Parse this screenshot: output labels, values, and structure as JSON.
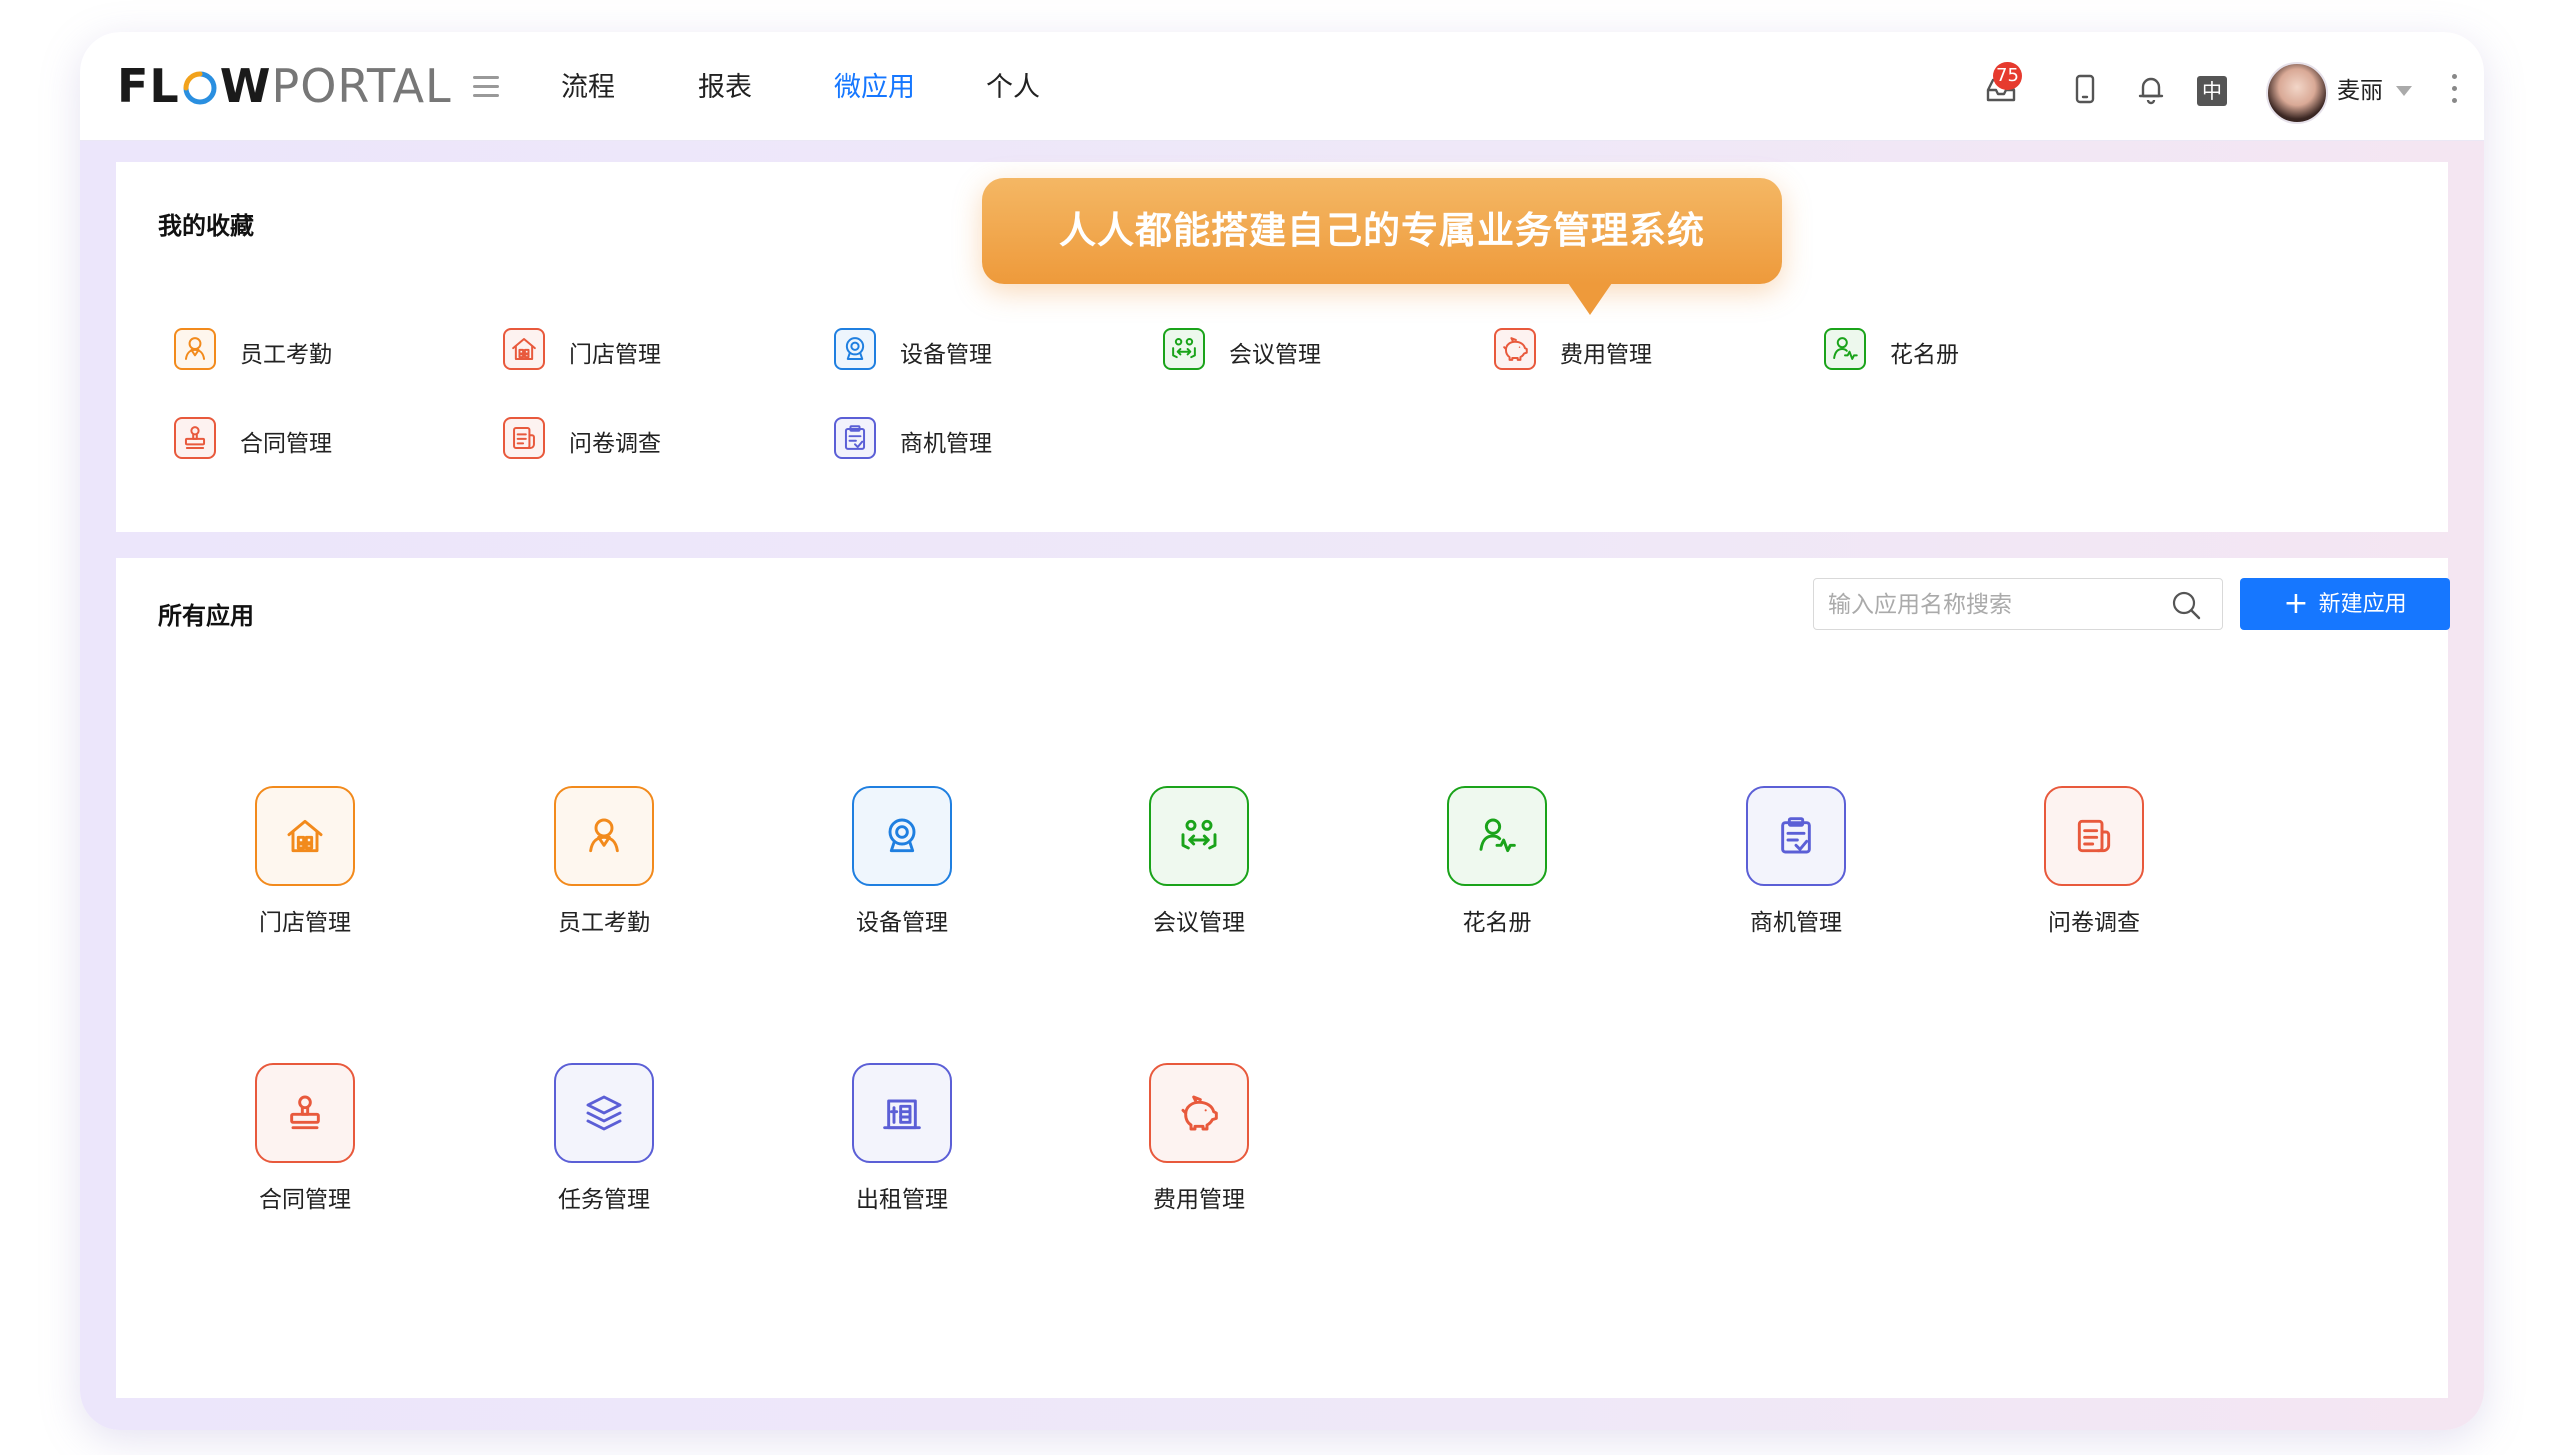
{
  "brand": {
    "logo_bold": "FL",
    "logo_o_icon": "flow-o-logo-icon",
    "logo_bold2": "W",
    "logo_light": "PORTAL"
  },
  "nav": {
    "items": [
      {
        "label": "流程"
      },
      {
        "label": "报表"
      },
      {
        "label": "微应用"
      },
      {
        "label": "个人"
      }
    ],
    "active": "微应用"
  },
  "header": {
    "inbox_badge": "75",
    "lang_label": "中",
    "user_name": "麦丽",
    "icons": [
      "inbox-icon",
      "mobile-icon",
      "bell-icon",
      "language-icon",
      "more-vertical-icon"
    ]
  },
  "tooltip": {
    "text": "人人都能搭建自己的专属业务管理系统"
  },
  "favorites": {
    "title": "我的收藏",
    "items": [
      {
        "label": "员工考勤",
        "icon": "person-icon",
        "color": "#f28a1c"
      },
      {
        "label": "门店管理",
        "icon": "store-icon",
        "color": "#e8593c"
      },
      {
        "label": "设备管理",
        "icon": "webcam-icon",
        "color": "#1f7fe0"
      },
      {
        "label": "会议管理",
        "icon": "meeting-icon",
        "color": "#1aa31a"
      },
      {
        "label": "费用管理",
        "icon": "piggy-bank-icon",
        "color": "#e8593c"
      },
      {
        "label": "花名册",
        "icon": "roster-icon",
        "color": "#1aa31a"
      },
      {
        "label": "合同管理",
        "icon": "stamp-icon",
        "color": "#e8593c"
      },
      {
        "label": "问卷调查",
        "icon": "survey-icon",
        "color": "#e8593c"
      },
      {
        "label": "商机管理",
        "icon": "clipboard-icon",
        "color": "#5b5fd6"
      }
    ]
  },
  "apps": {
    "title": "所有应用",
    "search_placeholder": "输入应用名称搜索",
    "new_button_label": "新建应用",
    "items": [
      {
        "label": "门店管理",
        "icon": "store-icon",
        "color": "#f28a1c"
      },
      {
        "label": "员工考勤",
        "icon": "person-icon",
        "color": "#f28a1c"
      },
      {
        "label": "设备管理",
        "icon": "webcam-icon",
        "color": "#1f7fe0"
      },
      {
        "label": "会议管理",
        "icon": "meeting-icon",
        "color": "#1aa31a"
      },
      {
        "label": "花名册",
        "icon": "roster-icon",
        "color": "#1aa31a"
      },
      {
        "label": "商机管理",
        "icon": "clipboard-icon",
        "color": "#5b5fd6"
      },
      {
        "label": "问卷调查",
        "icon": "survey-icon",
        "color": "#e8593c"
      },
      {
        "label": "合同管理",
        "icon": "stamp-icon",
        "color": "#e8593c"
      },
      {
        "label": "任务管理",
        "icon": "layers-icon",
        "color": "#5b5fd6"
      },
      {
        "label": "出租管理",
        "icon": "building-icon",
        "color": "#5b5fd6"
      },
      {
        "label": "费用管理",
        "icon": "piggy-bank-icon",
        "color": "#e8593c"
      }
    ]
  }
}
